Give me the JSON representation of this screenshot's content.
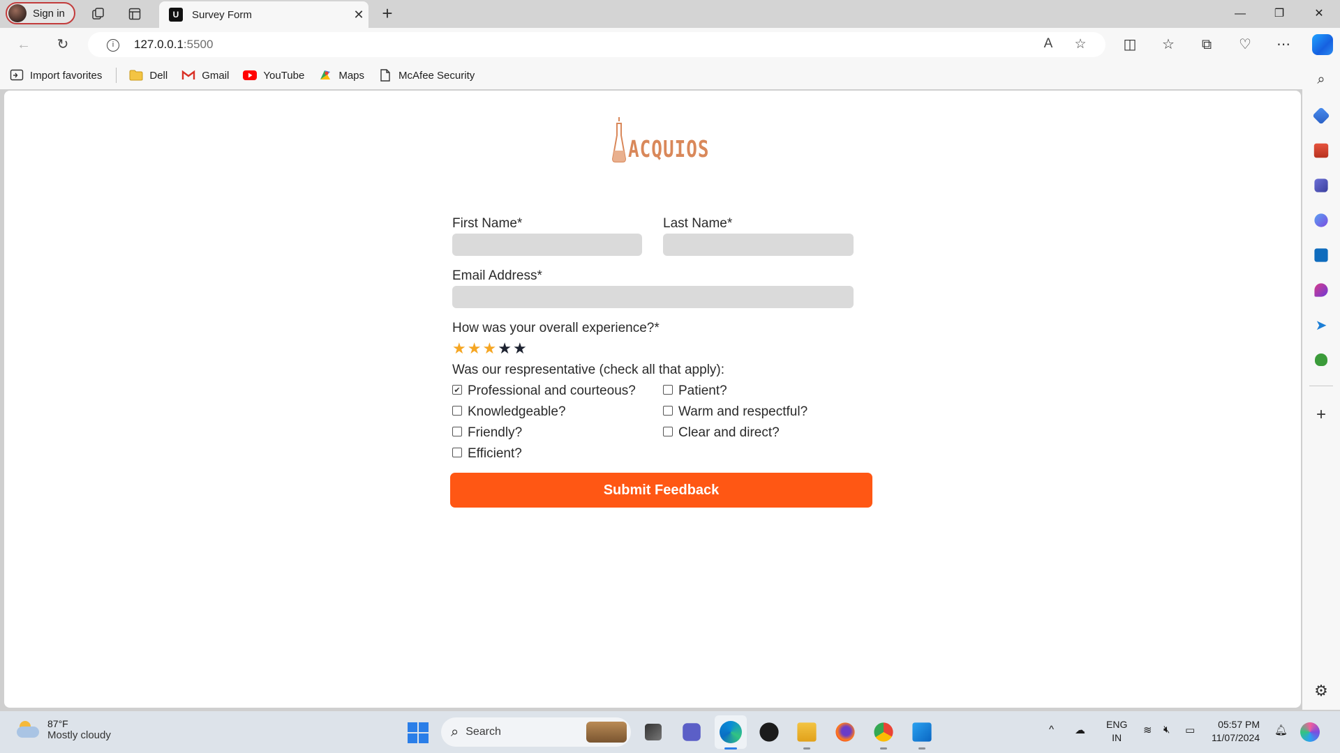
{
  "browser": {
    "profile_label": "Sign in",
    "tab_title": "Survey Form",
    "tab_favicon": "U",
    "url_host": "127.0.0.1",
    "url_port": ":5500"
  },
  "favorites": [
    {
      "label": "Import favorites",
      "icon": "import-icon"
    },
    {
      "label": "Dell",
      "icon": "folder-icon"
    },
    {
      "label": "Gmail",
      "icon": "gmail-icon"
    },
    {
      "label": "YouTube",
      "icon": "youtube-icon"
    },
    {
      "label": "Maps",
      "icon": "maps-icon"
    },
    {
      "label": "McAfee Security",
      "icon": "page-icon"
    }
  ],
  "page": {
    "logo_text": "ACQUIOS",
    "first_name_label": "First Name*",
    "last_name_label": "Last Name*",
    "email_label": "Email Address*",
    "experience_label": "How was your overall experience?*",
    "rating": 3,
    "rating_max": 5,
    "rep_label": "Was our respresentative (check all that apply):",
    "options": [
      {
        "label": "Professional and courteous?",
        "checked": true
      },
      {
        "label": "Patient?",
        "checked": false
      },
      {
        "label": "Knowledgeable?",
        "checked": false
      },
      {
        "label": "Warm and respectful?",
        "checked": false
      },
      {
        "label": "Friendly?",
        "checked": false
      },
      {
        "label": "Clear and direct?",
        "checked": false
      },
      {
        "label": "Efficient?",
        "checked": false
      }
    ],
    "submit_label": "Submit Feedback"
  },
  "taskbar": {
    "temp": "87°F",
    "weather": "Mostly cloudy",
    "search_placeholder": "Search",
    "lang_line1": "ENG",
    "lang_line2": "IN",
    "time": "05:57 PM",
    "date": "11/07/2024"
  },
  "colors": {
    "accent": "#ff5714",
    "star_on": "#f5a623",
    "star_off": "#1d2230",
    "logo": "#d9885a"
  }
}
